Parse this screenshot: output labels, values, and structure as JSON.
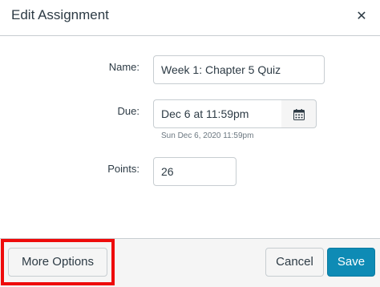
{
  "dialog": {
    "title": "Edit Assignment",
    "close_icon": "close-icon",
    "close_glyph": "✕"
  },
  "form": {
    "name_label": "Name:",
    "name_value": "Week 1: Chapter 5 Quiz",
    "due_label": "Due:",
    "due_value": "Dec 6 at 11:59pm",
    "due_hint": "Sun Dec 6, 2020 11:59pm",
    "calendar_icon": "calendar-icon",
    "points_label": "Points:",
    "points_value": "26"
  },
  "footer": {
    "more_options_label": "More Options",
    "cancel_label": "Cancel",
    "save_label": "Save"
  },
  "colors": {
    "primary": "#0e8bb5",
    "highlight": "#ee0b0b",
    "text": "#2d3b45",
    "border": "#c7cdd1"
  }
}
